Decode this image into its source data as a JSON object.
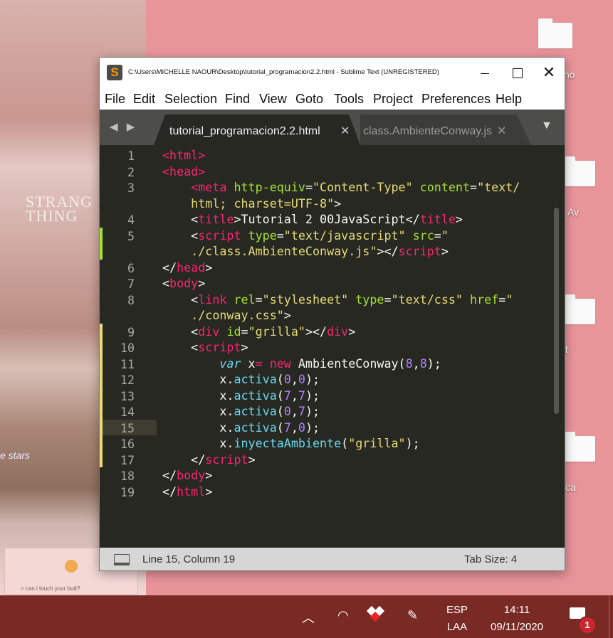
{
  "window": {
    "title": "C:\\Users\\MICHELLE NAOUR\\Desktop\\tutorial_programacion2.2.html - Sublime Text (UNREGISTERED)",
    "close_glyph": "✕"
  },
  "menu": [
    "File",
    "Edit",
    "Selection",
    "Find",
    "View",
    "Goto",
    "Tools",
    "Project",
    "Preferences",
    "Help"
  ],
  "tabs": {
    "nav": "◀ ▶",
    "active": {
      "label": "tutorial_programacion2.2.html",
      "close": "✕"
    },
    "inactive": {
      "label": "class.AmbienteConway.js",
      "close": "✕"
    },
    "dropdown": "▼"
  },
  "editor": {
    "current_line": 15,
    "lines": [
      {
        "n": "1",
        "tokens": [
          [
            "tag",
            "<"
          ],
          [
            "tag",
            "html"
          ],
          [
            "tag",
            ">"
          ]
        ]
      },
      {
        "n": "2",
        "tokens": [
          [
            "tag",
            "<"
          ],
          [
            "tag",
            "head"
          ],
          [
            "tag",
            ">"
          ]
        ]
      },
      {
        "n": "3",
        "tokens": [
          [
            "plain",
            "    "
          ],
          [
            "tag",
            "<meta "
          ],
          [
            "attr",
            "http-equiv"
          ],
          [
            "plain",
            "="
          ],
          [
            "str",
            "\"Content-Type\""
          ],
          [
            "plain",
            " "
          ],
          [
            "attr",
            "content"
          ],
          [
            "plain",
            "="
          ],
          [
            "str",
            "\"text/"
          ]
        ]
      },
      {
        "n": "",
        "tokens": [
          [
            "str",
            "    html; charset=UTF-8\""
          ],
          [
            "plain",
            ">"
          ]
        ]
      },
      {
        "n": "4",
        "tokens": [
          [
            "plain",
            "    <"
          ],
          [
            "tag",
            "title"
          ],
          [
            "plain",
            ">Tutorial 2 00JavaScript</"
          ],
          [
            "tag",
            "title"
          ],
          [
            "plain",
            ">"
          ]
        ]
      },
      {
        "n": "5",
        "tokens": [
          [
            "plain",
            "    <"
          ],
          [
            "tag",
            "script "
          ],
          [
            "attr",
            "type"
          ],
          [
            "plain",
            "="
          ],
          [
            "str",
            "\"text/javascript\""
          ],
          [
            "plain",
            " "
          ],
          [
            "attr",
            "src"
          ],
          [
            "plain",
            "="
          ],
          [
            "str",
            "\""
          ]
        ]
      },
      {
        "n": "",
        "tokens": [
          [
            "str",
            "    ./class.AmbienteConway.js\""
          ],
          [
            "plain",
            "></"
          ],
          [
            "tag",
            "script"
          ],
          [
            "plain",
            ">"
          ]
        ]
      },
      {
        "n": "6",
        "tokens": [
          [
            "plain",
            "</"
          ],
          [
            "tag",
            "head"
          ],
          [
            "plain",
            ">"
          ]
        ]
      },
      {
        "n": "7",
        "tokens": [
          [
            "plain",
            "<"
          ],
          [
            "tag",
            "body"
          ],
          [
            "plain",
            ">"
          ]
        ]
      },
      {
        "n": "8",
        "tokens": [
          [
            "plain",
            "    <"
          ],
          [
            "tag",
            "link "
          ],
          [
            "attr",
            "rel"
          ],
          [
            "plain",
            "="
          ],
          [
            "str",
            "\"stylesheet\""
          ],
          [
            "plain",
            " "
          ],
          [
            "attr",
            "type"
          ],
          [
            "plain",
            "="
          ],
          [
            "str",
            "\"text/css\""
          ],
          [
            "plain",
            " "
          ],
          [
            "attr",
            "href"
          ],
          [
            "plain",
            "="
          ],
          [
            "str",
            "\""
          ]
        ]
      },
      {
        "n": "",
        "tokens": [
          [
            "str",
            "    ./conway.css\""
          ],
          [
            "plain",
            ">"
          ]
        ]
      },
      {
        "n": "9",
        "tokens": [
          [
            "plain",
            "    <"
          ],
          [
            "tag",
            "div "
          ],
          [
            "attr",
            "id"
          ],
          [
            "plain",
            "="
          ],
          [
            "str",
            "\"grilla\""
          ],
          [
            "plain",
            "></"
          ],
          [
            "tag",
            "div"
          ],
          [
            "plain",
            ">"
          ]
        ]
      },
      {
        "n": "10",
        "tokens": [
          [
            "plain",
            "    <"
          ],
          [
            "tag",
            "script"
          ],
          [
            "plain",
            ">"
          ]
        ]
      },
      {
        "n": "11",
        "tokens": [
          [
            "plain",
            "        "
          ],
          [
            "kw",
            "var"
          ],
          [
            "plain",
            " x"
          ],
          [
            "op",
            "="
          ],
          [
            "plain",
            " "
          ],
          [
            "op",
            "new"
          ],
          [
            "plain",
            " AmbienteConway("
          ],
          [
            "num",
            "8"
          ],
          [
            "plain",
            ","
          ],
          [
            "num",
            "8"
          ],
          [
            "plain",
            ");"
          ]
        ]
      },
      {
        "n": "12",
        "tokens": [
          [
            "plain",
            "        x."
          ],
          [
            "fn",
            "activa"
          ],
          [
            "plain",
            "("
          ],
          [
            "num",
            "0"
          ],
          [
            "plain",
            ","
          ],
          [
            "num",
            "0"
          ],
          [
            "plain",
            ");"
          ]
        ]
      },
      {
        "n": "13",
        "tokens": [
          [
            "plain",
            "        x."
          ],
          [
            "fn",
            "activa"
          ],
          [
            "plain",
            "("
          ],
          [
            "num",
            "7"
          ],
          [
            "plain",
            ","
          ],
          [
            "num",
            "7"
          ],
          [
            "plain",
            ");"
          ]
        ]
      },
      {
        "n": "14",
        "tokens": [
          [
            "plain",
            "        x."
          ],
          [
            "fn",
            "activa"
          ],
          [
            "plain",
            "("
          ],
          [
            "num",
            "0"
          ],
          [
            "plain",
            ","
          ],
          [
            "num",
            "7"
          ],
          [
            "plain",
            ");"
          ]
        ]
      },
      {
        "n": "15",
        "tokens": [
          [
            "plain",
            "        x."
          ],
          [
            "fn",
            "activa"
          ],
          [
            "plain",
            "("
          ],
          [
            "num",
            "7"
          ],
          [
            "plain",
            ","
          ],
          [
            "num",
            "0"
          ],
          [
            "plain",
            ");"
          ]
        ]
      },
      {
        "n": "16",
        "tokens": [
          [
            "plain",
            "        x."
          ],
          [
            "fn",
            "inyectaAmbiente"
          ],
          [
            "plain",
            "("
          ],
          [
            "str",
            "\"grilla\""
          ],
          [
            "plain",
            ");"
          ]
        ]
      },
      {
        "n": "17",
        "tokens": [
          [
            "plain",
            "    </"
          ],
          [
            "tag",
            "script"
          ],
          [
            "plain",
            ">"
          ]
        ]
      },
      {
        "n": "18",
        "tokens": [
          [
            "plain",
            "</"
          ],
          [
            "tag",
            "body"
          ],
          [
            "plain",
            ">"
          ]
        ]
      },
      {
        "n": "19",
        "tokens": [
          [
            "plain",
            "</"
          ],
          [
            "tag",
            "html"
          ],
          [
            "plain",
            ">"
          ]
        ]
      }
    ],
    "colors": {
      "tag": "#f92672",
      "attr": "#a6e22e",
      "str": "#e6db74",
      "num": "#ae81ff",
      "kw": "#66d9ef",
      "fn": "#66d9ef",
      "op": "#f92672",
      "plain": "#f8f8f2",
      "mod_added": "#a6e22e",
      "mod_changed": "#e6db74"
    },
    "modified_lines": {
      "added": [
        "5"
      ],
      "changed": [
        "9",
        "10",
        "11",
        "12",
        "13",
        "14",
        "15",
        "16",
        "17"
      ]
    }
  },
  "status": {
    "position": "Line 15, Column 19",
    "tab_size": "Tab Size: 4"
  },
  "desktop": {
    "labels": [
      "no",
      "Av",
      "t",
      "ca"
    ],
    "wallpaper_text_1": "STRANG\nTHING",
    "wallpaper_text_2": "e stars",
    "note_text": "> can i touch your butt?"
  },
  "taskbar": {
    "lang_top": "ESP",
    "lang_bottom": "LAA",
    "time": "14:11",
    "date": "09/11/2020",
    "notification_count": "1"
  }
}
